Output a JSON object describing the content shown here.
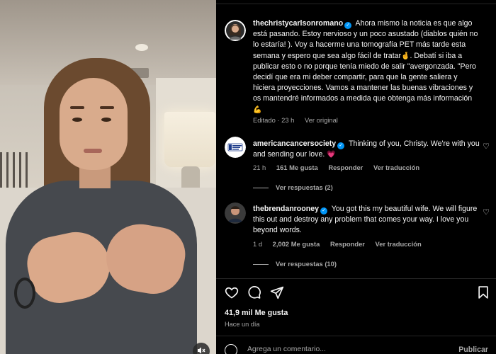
{
  "post": {
    "caption": {
      "username": "thechristycarlsonromano",
      "text": "Ahora mismo la noticia es que algo está pasando. Estoy nervioso y un poco asustado (diablos quién no lo estaría! ). Voy a hacerme una tomografía PET más tarde esta semana y espero que sea algo fácil de tratar",
      "text_after_emoji": ". Debatí si iba a publicar esto o no porque tenía miedo de salir \"avergonzada. \"Pero decidí que era mi deber compartir, para que la gente saliera y hiciera proyecciones. Vamos a mantener las buenas vibraciones y os mantendré informados a medida que obtenga más información",
      "emoji1": "🤞",
      "emoji2": "💪",
      "edited": "Editado · 23 h",
      "see_original": "Ver original"
    },
    "comments": [
      {
        "username": "americancancersociety",
        "text": "Thinking of you, Christy. We're with you and sending our love.",
        "emoji": "💗",
        "time": "21 h",
        "likes": "161 Me gusta",
        "reply": "Responder",
        "translate": "Ver traducción",
        "view_replies": "Ver respuestas (2)"
      },
      {
        "username": "thebrendanrooney",
        "text": "You got this my beautiful wife. We will figure this out and destroy any problem that comes your way. I love you beyond words.",
        "time": "1 d",
        "likes": "2,002 Me gusta",
        "reply": "Responder",
        "translate": "Ver traducción",
        "view_replies": "Ver respuestas (10)"
      }
    ],
    "like_count": "41,9 mil Me gusta",
    "posted": "Hace un día",
    "add_comment_placeholder": "Agrega un comentario...",
    "publish_label": "Publicar"
  },
  "icons": {
    "heart": "heart-icon",
    "comment": "comment-icon",
    "share": "share-icon",
    "save": "bookmark-icon",
    "emoji": "smile-icon",
    "mute": "speaker-muted-icon"
  },
  "colors": {
    "verified": "#0095f6",
    "background": "#000000",
    "secondary_text": "#a8a8a8"
  }
}
